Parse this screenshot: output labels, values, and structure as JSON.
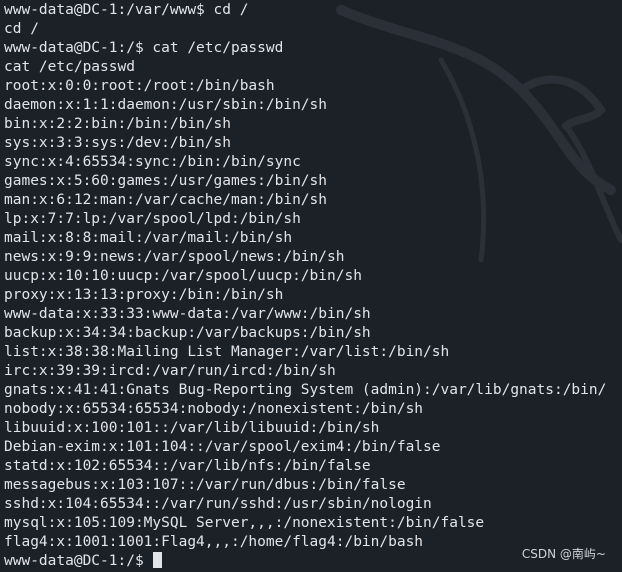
{
  "colors": {
    "background": "#1c2027",
    "text": "#e2e4e8",
    "cursor": "#e2e4e8"
  },
  "terminal": {
    "lines": [
      "www-data@DC-1:/var/www$ cd /",
      "cd /",
      "www-data@DC-1:/$ cat /etc/passwd",
      "cat /etc/passwd",
      "root:x:0:0:root:/root:/bin/bash",
      "daemon:x:1:1:daemon:/usr/sbin:/bin/sh",
      "bin:x:2:2:bin:/bin:/bin/sh",
      "sys:x:3:3:sys:/dev:/bin/sh",
      "sync:x:4:65534:sync:/bin:/bin/sync",
      "games:x:5:60:games:/usr/games:/bin/sh",
      "man:x:6:12:man:/var/cache/man:/bin/sh",
      "lp:x:7:7:lp:/var/spool/lpd:/bin/sh",
      "mail:x:8:8:mail:/var/mail:/bin/sh",
      "news:x:9:9:news:/var/spool/news:/bin/sh",
      "uucp:x:10:10:uucp:/var/spool/uucp:/bin/sh",
      "proxy:x:13:13:proxy:/bin:/bin/sh",
      "www-data:x:33:33:www-data:/var/www:/bin/sh",
      "backup:x:34:34:backup:/var/backups:/bin/sh",
      "list:x:38:38:Mailing List Manager:/var/list:/bin/sh",
      "irc:x:39:39:ircd:/var/run/ircd:/bin/sh",
      "gnats:x:41:41:Gnats Bug-Reporting System (admin):/var/lib/gnats:/bin/",
      "nobody:x:65534:65534:nobody:/nonexistent:/bin/sh",
      "libuuid:x:100:101::/var/lib/libuuid:/bin/sh",
      "Debian-exim:x:101:104::/var/spool/exim4:/bin/false",
      "statd:x:102:65534::/var/lib/nfs:/bin/false",
      "messagebus:x:103:107::/var/run/dbus:/bin/false",
      "sshd:x:104:65534::/var/run/sshd:/usr/sbin/nologin",
      "mysql:x:105:109:MySQL Server,,,:/nonexistent:/bin/false",
      "flag4:x:1001:1001:Flag4,,,:/home/flag4:/bin/bash"
    ],
    "prompt": "www-data@DC-1:/$ "
  },
  "background_logo": "kali-dragon-icon",
  "watermark": "CSDN @南屿~"
}
